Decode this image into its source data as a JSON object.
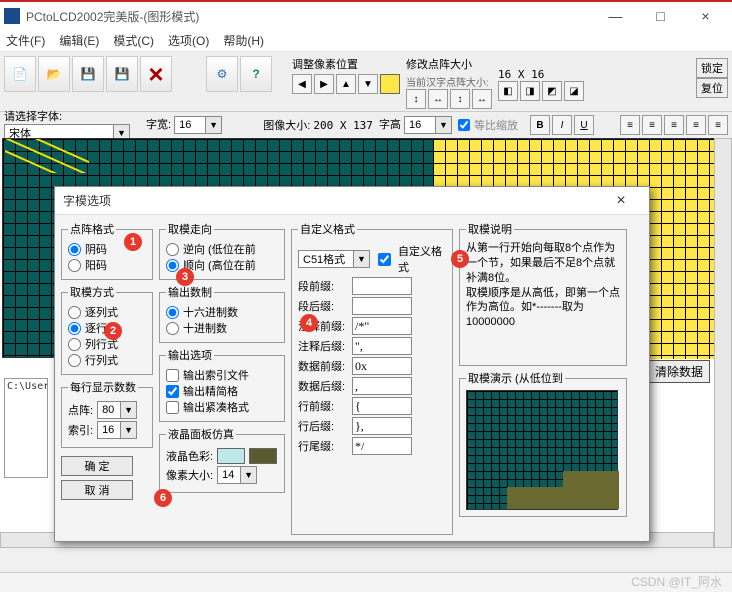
{
  "window": {
    "title": "PCtoLCD2002完美版-(图形模式)",
    "min": "—",
    "max": "□",
    "close": "×"
  },
  "menu": {
    "file": "文件(F)",
    "edit": "编辑(E)",
    "mode": "模式(C)",
    "options": "选项(O)",
    "help": "帮助(H)"
  },
  "toolbar": {
    "adjust_pixel": "调整像素位置",
    "change_matrix": "修改点阵大小",
    "current_matrix_label": "当前汉字点阵大小:",
    "matrix_size": "16 X 16",
    "lock": "锁定",
    "reset": "复位",
    "image_size_label": "图像大小:",
    "image_size_val": "200 X 137",
    "font_prompt": "请选择字体:",
    "font_name": "宋体",
    "char_width_label": "字宽:",
    "char_width_val": "16",
    "char_height_label": "字高",
    "char_height_val": "16",
    "keep_ratio": "等比缩放",
    "bold": "B",
    "italic": "I",
    "underline": "U"
  },
  "canvas": {
    "path": "C:\\Users",
    "clear_data": "清除数据"
  },
  "dialog": {
    "title": "字模选项",
    "close": "×",
    "matrix_format": {
      "legend": "点阵格式",
      "opt1": "阴码",
      "opt2": "阳码"
    },
    "fetch_mode": {
      "legend": "取模方式",
      "opt1": "逐列式",
      "opt2": "逐行式",
      "opt3": "列行式",
      "opt4": "行列式"
    },
    "rows_per_line": {
      "legend": "每行显示数数",
      "label1": "点阵:",
      "val1": "80",
      "label2": "索引:",
      "val2": "16"
    },
    "ok": "确  定",
    "cancel": "取  消",
    "fetch_dir": {
      "legend": "取模走向",
      "opt1": "逆向 (低位在前",
      "opt2": "顺向 (高位在前"
    },
    "output_radix": {
      "legend": "输出数制",
      "opt1": "十六进制数",
      "opt2": "十进制数"
    },
    "output_opts": {
      "legend": "输出选项",
      "chk1": "输出索引文件",
      "chk2": "输出精简格",
      "chk3": "输出紧凑格式"
    },
    "lcd_sim": {
      "legend": "液晶面板仿真",
      "color_label": "液晶色彩:",
      "pixel_label": "像素大小:",
      "pixel_val": "14"
    },
    "custom_fmt": {
      "legend": "自定义格式",
      "preset": "C51格式",
      "custom_chk": "自定义格式",
      "seg_prefix": "段前缀:",
      "seg_prefix_v": "",
      "seg_suffix": "段后缀:",
      "seg_suffix_v": "",
      "comment_prefix": "注释前缀:",
      "comment_prefix_v": "/*\"",
      "comment_suffix": "注释后缀:",
      "comment_suffix_v": "\",",
      "data_prefix": "数据前缀:",
      "data_prefix_v": "0x",
      "data_suffix": "数据后缀:",
      "data_suffix_v": ",",
      "line_prefix": "行前缀:",
      "line_prefix_v": "{",
      "line_suffix": "行后缀:",
      "line_suffix_v": "},",
      "tail_suffix": "行尾缀:",
      "tail_suffix_v": "*/"
    },
    "explain": {
      "legend": "取模说明",
      "text": "从第一行开始向每取8个点作为一个节，如果最后不足8个点就补满8位。\n取模顺序是从高低，即第一个点作为高位。如*-------取为10000000"
    },
    "demo": {
      "legend": "取模演示 (从低位到"
    }
  },
  "annotations": [
    "1",
    "2",
    "3",
    "4",
    "5",
    "6"
  ],
  "watermark": "CSDN @IT_阿水"
}
